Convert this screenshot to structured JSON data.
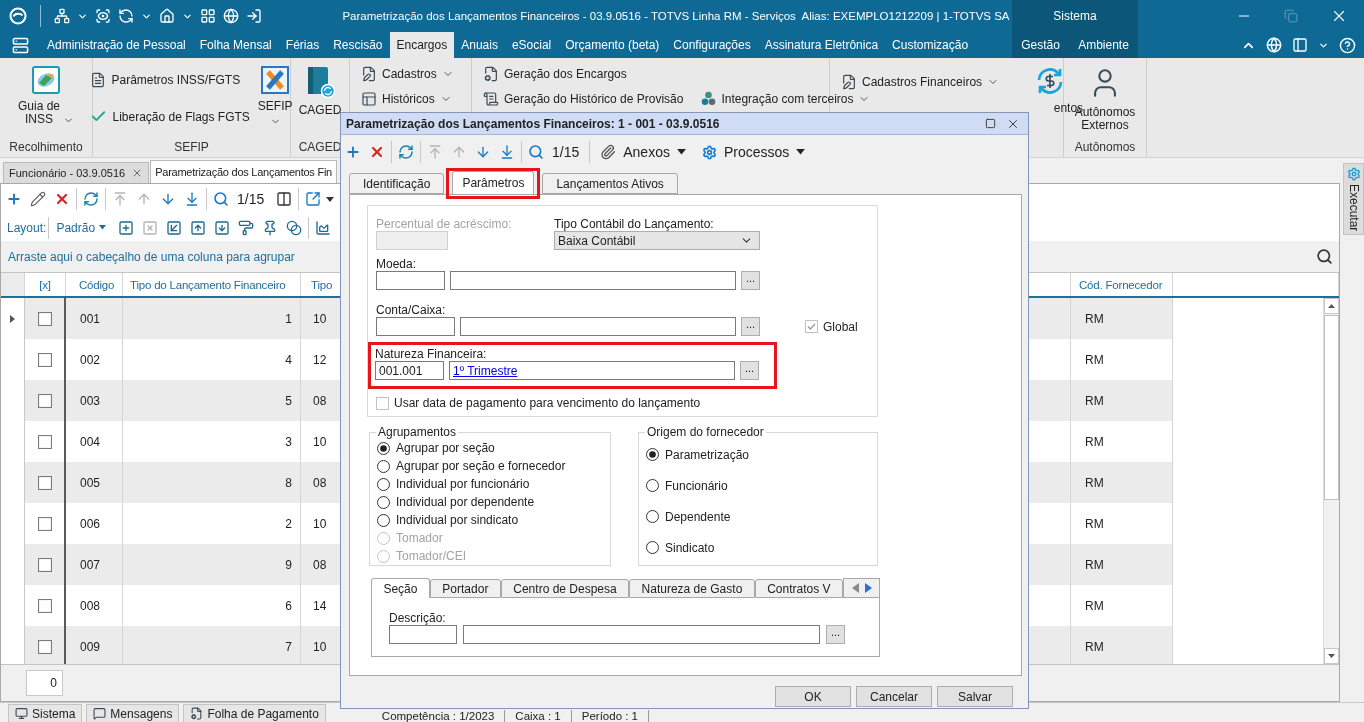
{
  "title_bar": {
    "title": "Parametrização dos Lançamentos Financeiros - 03.9.0516 - TOTVS Linha RM - Serviços  Alias: EXEMPLO1212209 | 1-TOTVS SA",
    "section": "Sistema"
  },
  "menu_tabs": [
    {
      "label": "Administração de Pessoal",
      "kind": "module",
      "selected": false
    },
    {
      "label": "Folha Mensal",
      "kind": "module",
      "selected": false
    },
    {
      "label": "Férias",
      "kind": "module",
      "selected": false
    },
    {
      "label": "Rescisão",
      "kind": "module",
      "selected": false
    },
    {
      "label": "Encargos",
      "kind": "module",
      "selected": true
    },
    {
      "label": "Anuais",
      "kind": "module",
      "selected": false
    },
    {
      "label": "eSocial",
      "kind": "module",
      "selected": false
    },
    {
      "label": "Orçamento (beta)",
      "kind": "module",
      "selected": false
    },
    {
      "label": "Configurações",
      "kind": "module",
      "selected": false
    },
    {
      "label": "Assinatura Eletrônica",
      "kind": "module",
      "selected": false
    },
    {
      "label": "Customização",
      "kind": "module",
      "selected": false
    },
    {
      "label": "Gestão",
      "kind": "system",
      "selected": false
    },
    {
      "label": "Ambiente",
      "kind": "system",
      "selected": false
    }
  ],
  "ribbon": [
    {
      "label": "Recolhimento",
      "columns": [
        {
          "kind": "large",
          "items": [
            {
              "label": "Guia de\nINSS",
              "dropdown": true
            }
          ]
        }
      ]
    },
    {
      "label": "SEFIP",
      "columns": [
        {
          "kind": "even",
          "items": [
            {
              "label": "Parâmetros INSS/FGTS",
              "dropdown": false
            },
            {
              "label": "Liberação de Flags FGTS",
              "dropdown": false
            }
          ]
        },
        {
          "kind": "large",
          "items": [
            {
              "label": "SEFIP",
              "dropdown": true
            }
          ]
        }
      ]
    },
    {
      "label": "CAGED",
      "columns": [
        {
          "kind": "large",
          "items": [
            {
              "label": "CAGED",
              "dropdown": false
            }
          ]
        }
      ]
    },
    {
      "columns": [
        {
          "kind": "stack",
          "items": [
            {
              "label": "Cadastros",
              "dropdown": true
            },
            {
              "label": "Históricos",
              "dropdown": true
            }
          ]
        }
      ]
    },
    {
      "columns": [
        {
          "kind": "stack",
          "items": [
            {
              "label": "Geração dos Encargos",
              "dropdown": false
            },
            {
              "label": "Geração do Histórico de Provisão",
              "dropdown": false
            }
          ]
        },
        {
          "kind": "middle",
          "items": [
            {
              "label": "Integração com terceiros",
              "dropdown": true
            }
          ]
        }
      ]
    },
    {
      "columns": [
        {
          "kind": "upper",
          "items": [
            {
              "label": "Cadastros Financeiros",
              "dropdown": true
            }
          ]
        },
        {
          "kind": "large",
          "items": [
            {
              "label": "entos",
              "dropdown": false
            }
          ]
        }
      ]
    },
    {
      "label": "Autônomos",
      "columns": [
        {
          "kind": "large",
          "items": [
            {
              "label": "Autônomos\nExternos",
              "dropdown": false
            }
          ]
        }
      ]
    }
  ],
  "doc_tabs": [
    {
      "label": "Funcionário - 03.9.0516",
      "selected": false,
      "closable": true
    },
    {
      "label": "Parametrização dos Lançamentos Fin",
      "selected": true,
      "closable": false
    }
  ],
  "side_tab": "Executar",
  "main_toolbar": [
    {
      "kind": "add",
      "disabled": false
    },
    {
      "kind": "edit",
      "disabled": false
    },
    {
      "kind": "delete",
      "disabled": false
    },
    {
      "kind": "refresh",
      "disabled": false
    },
    {
      "kind": "first",
      "disabled": true
    },
    {
      "kind": "previous",
      "disabled": true
    },
    {
      "kind": "next",
      "disabled": false
    },
    {
      "kind": "last",
      "disabled": false
    },
    {
      "kind": "search",
      "disabled": false
    },
    {
      "kind": "record",
      "label": "1/15"
    },
    {
      "kind": "columns",
      "disabled": false
    },
    {
      "kind": "export",
      "disabled": false
    }
  ],
  "layout_bar": {
    "label": "Layout:",
    "value": "Padrão",
    "tools": [
      {
        "kind": "add",
        "disabled": false
      },
      {
        "kind": "remove",
        "disabled": true
      },
      {
        "kind": "wrap",
        "disabled": false
      },
      {
        "kind": "upload",
        "disabled": false
      },
      {
        "kind": "download",
        "disabled": false
      },
      {
        "kind": "paint",
        "disabled": false
      },
      {
        "kind": "pin",
        "disabled": false
      },
      {
        "kind": "circles",
        "disabled": false
      },
      {
        "kind": "chart",
        "disabled": false
      }
    ]
  },
  "group_hint": "Arraste aqui o cabeçalho de uma coluna para agrupar",
  "table": {
    "check_header": "[x]",
    "columns": [
      "Código",
      "Tipo do Lançamento Financeiro",
      "Tipo",
      "Cód. Fornecedor"
    ],
    "rows": [
      {
        "selected": true,
        "checked": false,
        "cells": [
          "001",
          "1",
          "10",
          "RM"
        ]
      },
      {
        "selected": false,
        "checked": false,
        "cells": [
          "002",
          "4",
          "12",
          "RM"
        ]
      },
      {
        "selected": false,
        "checked": false,
        "cells": [
          "003",
          "5",
          "08",
          "RM"
        ]
      },
      {
        "selected": false,
        "checked": false,
        "cells": [
          "004",
          "3",
          "10",
          "RM"
        ]
      },
      {
        "selected": false,
        "checked": false,
        "cells": [
          "005",
          "8",
          "08",
          "RM"
        ]
      },
      {
        "selected": false,
        "checked": false,
        "cells": [
          "006",
          "2",
          "10",
          "RM"
        ]
      },
      {
        "selected": false,
        "checked": false,
        "cells": [
          "007",
          "9",
          "08",
          "RM"
        ]
      },
      {
        "selected": false,
        "checked": false,
        "cells": [
          "008",
          "6",
          "14",
          "RM"
        ]
      },
      {
        "selected": false,
        "checked": false,
        "cells": [
          "009",
          "7",
          "10",
          "RM"
        ]
      }
    ]
  },
  "record_count": "0",
  "status_bar": {
    "tabs": [
      "Sistema",
      "Mensagens",
      "Folha de Pagamento"
    ],
    "fields": [
      "Competência : 1/2023",
      "Caixa : 1",
      "Período : 1"
    ]
  },
  "dialog": {
    "title": "Parametrização dos Lançamentos Financeiros: 1 - 001 - 03.9.0516",
    "toolbar": [
      {
        "kind": "add",
        "disabled": false
      },
      {
        "kind": "delete",
        "disabled": false
      },
      {
        "kind": "refresh",
        "disabled": false
      },
      {
        "kind": "first",
        "disabled": true
      },
      {
        "kind": "previous",
        "disabled": true
      },
      {
        "kind": "next",
        "disabled": false
      },
      {
        "kind": "last",
        "disabled": false
      },
      {
        "kind": "search",
        "disabled": false
      },
      {
        "kind": "record",
        "label": "1/15"
      },
      {
        "kind": "attachments",
        "label": "Anexos"
      },
      {
        "kind": "processes",
        "label": "Processos"
      }
    ],
    "tabs": [
      {
        "label": "Identificação",
        "selected": false,
        "highlighted": false
      },
      {
        "label": "Parâmetros",
        "selected": true,
        "highlighted": true
      },
      {
        "label": "Lançamentos Ativos",
        "selected": false,
        "highlighted": false
      }
    ],
    "percentual": {
      "label": "Percentual de acréscimo:",
      "disabled": true
    },
    "tipo_contabil": {
      "label": "Tipo Contábil do Lançamento:",
      "value": "Baixa Contábil"
    },
    "moeda": {
      "label": "Moeda:",
      "button": "..."
    },
    "conta_caixa": {
      "label": "Conta/Caixa:",
      "button": "..."
    },
    "global": {
      "label": "Global",
      "checked": true,
      "disabled": true
    },
    "natureza": {
      "label": "Natureza Financeira:",
      "code": "001.001",
      "description": "1º Trimestre",
      "button": "...",
      "highlighted": true
    },
    "usar_data": {
      "label": "Usar data de pagamento para vencimento do lançamento",
      "checked": false,
      "disabled": true
    },
    "agrupamentos": {
      "title": "Agrupamentos",
      "options": [
        {
          "label": "Agrupar por seção",
          "selected": true,
          "disabled": false
        },
        {
          "label": "Agrupar por seção e fornecedor",
          "selected": false,
          "disabled": false
        },
        {
          "label": "Individual por funcionário",
          "selected": false,
          "disabled": false
        },
        {
          "label": "Individual por dependente",
          "selected": false,
          "disabled": false
        },
        {
          "label": "Individual por sindicato",
          "selected": false,
          "disabled": false
        },
        {
          "label": "Tomador",
          "selected": false,
          "disabled": true
        },
        {
          "label": "Tomador/CEI",
          "selected": false,
          "disabled": true
        }
      ]
    },
    "origem": {
      "title": "Origem do fornecedor",
      "options": [
        {
          "label": "Parametrização",
          "selected": true,
          "disabled": false
        },
        {
          "label": "Funcionário",
          "selected": false,
          "disabled": false
        },
        {
          "label": "Dependente",
          "selected": false,
          "disabled": false
        },
        {
          "label": "Sindicato",
          "selected": false,
          "disabled": false
        }
      ]
    },
    "sub_tabs": [
      {
        "label": "Seção",
        "selected": true
      },
      {
        "label": "Portador",
        "selected": false
      },
      {
        "label": "Centro de Despesa",
        "selected": false
      },
      {
        "label": "Natureza de Gasto",
        "selected": false
      },
      {
        "label": "Contratos V",
        "selected": false
      }
    ],
    "descricao": {
      "label": "Descrição:",
      "button": "..."
    },
    "buttons": [
      "OK",
      "Cancelar",
      "Salvar"
    ]
  }
}
